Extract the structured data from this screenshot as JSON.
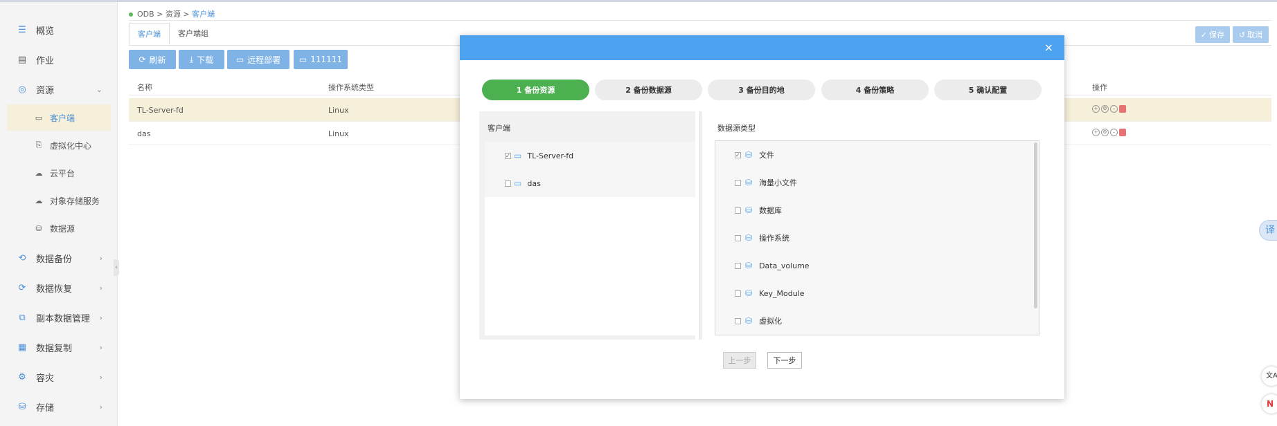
{
  "sidebar": {
    "items": [
      {
        "label": "概览",
        "icon": "list-icon"
      },
      {
        "label": "作业",
        "icon": "clipboard-icon"
      },
      {
        "label": "资源",
        "icon": "resource-icon"
      },
      {
        "label": "数据备份",
        "icon": "backup-icon"
      },
      {
        "label": "数据恢复",
        "icon": "restore-icon"
      },
      {
        "label": "副本数据管理",
        "icon": "copy-manage-icon"
      },
      {
        "label": "数据复制",
        "icon": "replicate-icon"
      },
      {
        "label": "容灾",
        "icon": "disaster-icon"
      },
      {
        "label": "存储",
        "icon": "storage-icon"
      }
    ],
    "subitems": [
      {
        "label": "客户端",
        "icon": "monitor-icon"
      },
      {
        "label": "虚拟化中心",
        "icon": "virtual-icon"
      },
      {
        "label": "云平台",
        "icon": "cloud-icon"
      },
      {
        "label": "对象存储服务",
        "icon": "object-cloud-icon"
      },
      {
        "label": "数据源",
        "icon": "database-icon"
      }
    ]
  },
  "breadcrumb": {
    "root": "ODB",
    "sep": ">",
    "mid": "资源",
    "current": "客户端"
  },
  "tabs": [
    "客户端",
    "客户端组"
  ],
  "toolbar": {
    "refresh": "刷新",
    "download": "下载",
    "remote_deploy": "远程部署",
    "custom": "111111"
  },
  "top_right": {
    "save": "保存",
    "cancel": "取消"
  },
  "table": {
    "headers": {
      "name": "名称",
      "os": "操作系统类型",
      "ops": "操作"
    },
    "rows": [
      {
        "name": "TL-Server-fd",
        "os": "Linux"
      },
      {
        "name": "das",
        "os": "Linux"
      }
    ]
  },
  "modal": {
    "close": "×",
    "steps": [
      "1 备份资源",
      "2 备份数据源",
      "3 备份目的地",
      "4 备份策略",
      "5 确认配置"
    ],
    "left_title": "客户端",
    "clients": [
      {
        "label": "TL-Server-fd",
        "checked": "✓"
      },
      {
        "label": "das",
        "checked": ""
      }
    ],
    "right_title": "数据源类型",
    "datasources": [
      {
        "label": "文件",
        "checked": "✓"
      },
      {
        "label": "海量小文件",
        "checked": ""
      },
      {
        "label": "数据库",
        "checked": ""
      },
      {
        "label": "操作系统",
        "checked": ""
      },
      {
        "label": "Data_volume",
        "checked": ""
      },
      {
        "label": "Key_Module",
        "checked": ""
      },
      {
        "label": "虚拟化",
        "checked": ""
      }
    ],
    "prev": "上一步",
    "next": "下一步"
  },
  "floating": {
    "translate": "译"
  },
  "colors": {
    "accent": "#4da3ef",
    "step_active": "#4caf50",
    "selected_row": "#f6efd9"
  }
}
